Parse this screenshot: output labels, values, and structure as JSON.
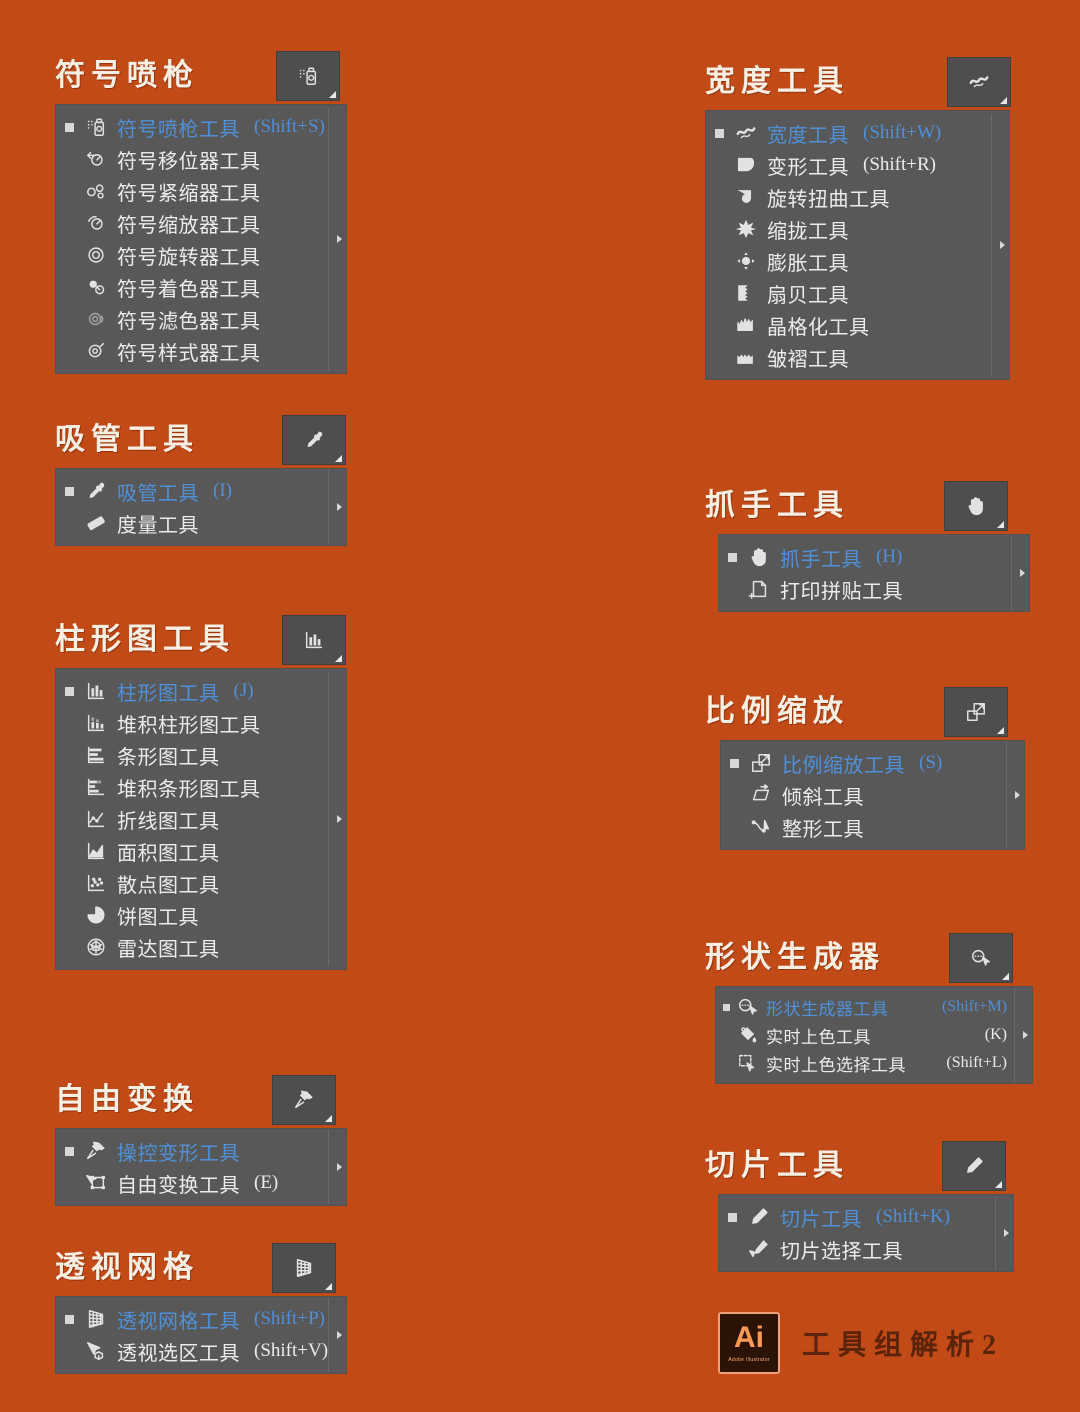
{
  "background_color": "#c14a17",
  "panel_color": "#585858",
  "highlight_color": "#4f90d8",
  "label_color": "#ececec",
  "title_color": "#f7efe3",
  "footer": {
    "logo_text": "Ai",
    "logo_sub": "Adobe Illustrator",
    "caption": "工具组解析2"
  },
  "groups": [
    {
      "id": "symbol-sprayer",
      "title": "符号喷枪",
      "head_icon": "symbol-sprayer-icon",
      "items": [
        {
          "label": "符号喷枪工具",
          "shortcut": "(Shift+S)",
          "selected": true,
          "icon": "symbol-sprayer-icon"
        },
        {
          "label": "符号移位器工具",
          "shortcut": "",
          "selected": false,
          "icon": "symbol-shifter-icon"
        },
        {
          "label": "符号紧缩器工具",
          "shortcut": "",
          "selected": false,
          "icon": "symbol-scruncher-icon"
        },
        {
          "label": "符号缩放器工具",
          "shortcut": "",
          "selected": false,
          "icon": "symbol-sizer-icon"
        },
        {
          "label": "符号旋转器工具",
          "shortcut": "",
          "selected": false,
          "icon": "symbol-spinner-icon"
        },
        {
          "label": "符号着色器工具",
          "shortcut": "",
          "selected": false,
          "icon": "symbol-stainer-icon"
        },
        {
          "label": "符号滤色器工具",
          "shortcut": "",
          "selected": false,
          "icon": "symbol-screener-icon"
        },
        {
          "label": "符号样式器工具",
          "shortcut": "",
          "selected": false,
          "icon": "symbol-styler-icon"
        }
      ]
    },
    {
      "id": "eyedropper",
      "title": "吸管工具",
      "head_icon": "eyedropper-icon",
      "items": [
        {
          "label": "吸管工具",
          "shortcut": "(I)",
          "selected": true,
          "icon": "eyedropper-icon"
        },
        {
          "label": "度量工具",
          "shortcut": "",
          "selected": false,
          "icon": "measure-icon"
        }
      ]
    },
    {
      "id": "column-graph",
      "title": "柱形图工具",
      "head_icon": "column-graph-icon",
      "items": [
        {
          "label": "柱形图工具",
          "shortcut": "(J)",
          "selected": true,
          "icon": "column-graph-icon"
        },
        {
          "label": "堆积柱形图工具",
          "shortcut": "",
          "selected": false,
          "icon": "stacked-column-graph-icon"
        },
        {
          "label": "条形图工具",
          "shortcut": "",
          "selected": false,
          "icon": "bar-graph-icon"
        },
        {
          "label": "堆积条形图工具",
          "shortcut": "",
          "selected": false,
          "icon": "stacked-bar-graph-icon"
        },
        {
          "label": "折线图工具",
          "shortcut": "",
          "selected": false,
          "icon": "line-graph-icon"
        },
        {
          "label": "面积图工具",
          "shortcut": "",
          "selected": false,
          "icon": "area-graph-icon"
        },
        {
          "label": "散点图工具",
          "shortcut": "",
          "selected": false,
          "icon": "scatter-graph-icon"
        },
        {
          "label": "饼图工具",
          "shortcut": "",
          "selected": false,
          "icon": "pie-graph-icon"
        },
        {
          "label": "雷达图工具",
          "shortcut": "",
          "selected": false,
          "icon": "radar-graph-icon"
        }
      ]
    },
    {
      "id": "free-transform",
      "title": "自由变换",
      "head_icon": "puppet-warp-icon",
      "items": [
        {
          "label": "操控变形工具",
          "shortcut": "",
          "selected": true,
          "icon": "puppet-warp-icon"
        },
        {
          "label": "自由变换工具",
          "shortcut": "(E)",
          "selected": false,
          "icon": "free-transform-icon"
        }
      ]
    },
    {
      "id": "perspective-grid",
      "title": "透视网格",
      "head_icon": "perspective-grid-icon",
      "items": [
        {
          "label": "透视网格工具",
          "shortcut": "(Shift+P)",
          "selected": true,
          "icon": "perspective-grid-icon"
        },
        {
          "label": "透视选区工具",
          "shortcut": "(Shift+V)",
          "selected": false,
          "icon": "perspective-selection-icon"
        }
      ]
    },
    {
      "id": "width-tool",
      "title": "宽度工具",
      "head_icon": "width-icon",
      "items": [
        {
          "label": "宽度工具",
          "shortcut": "(Shift+W)",
          "selected": true,
          "icon": "width-icon"
        },
        {
          "label": "变形工具",
          "shortcut": "(Shift+R)",
          "selected": false,
          "icon": "warp-icon"
        },
        {
          "label": "旋转扭曲工具",
          "shortcut": "",
          "selected": false,
          "icon": "twirl-icon"
        },
        {
          "label": "缩拢工具",
          "shortcut": "",
          "selected": false,
          "icon": "pucker-icon"
        },
        {
          "label": "膨胀工具",
          "shortcut": "",
          "selected": false,
          "icon": "bloat-icon"
        },
        {
          "label": "扇贝工具",
          "shortcut": "",
          "selected": false,
          "icon": "scallop-icon"
        },
        {
          "label": "晶格化工具",
          "shortcut": "",
          "selected": false,
          "icon": "crystallize-icon"
        },
        {
          "label": "皱褶工具",
          "shortcut": "",
          "selected": false,
          "icon": "wrinkle-icon"
        }
      ]
    },
    {
      "id": "hand-tool",
      "title": "抓手工具",
      "head_icon": "hand-icon",
      "items": [
        {
          "label": "抓手工具",
          "shortcut": "(H)",
          "selected": true,
          "icon": "hand-icon"
        },
        {
          "label": "打印拼贴工具",
          "shortcut": "",
          "selected": false,
          "icon": "print-tiling-icon"
        }
      ]
    },
    {
      "id": "scale-tool",
      "title": "比例缩放",
      "head_icon": "scale-icon",
      "items": [
        {
          "label": "比例缩放工具",
          "shortcut": "(S)",
          "selected": true,
          "icon": "scale-icon"
        },
        {
          "label": "倾斜工具",
          "shortcut": "",
          "selected": false,
          "icon": "shear-icon"
        },
        {
          "label": "整形工具",
          "shortcut": "",
          "selected": false,
          "icon": "reshape-icon"
        }
      ]
    },
    {
      "id": "shape-builder",
      "title": "形状生成器",
      "head_icon": "shape-builder-icon",
      "compact": true,
      "items": [
        {
          "label": "形状生成器工具",
          "shortcut": "(Shift+M)",
          "selected": true,
          "icon": "shape-builder-icon"
        },
        {
          "label": "实时上色工具",
          "shortcut": "(K)",
          "selected": false,
          "icon": "live-paint-bucket-icon"
        },
        {
          "label": "实时上色选择工具",
          "shortcut": "(Shift+L)",
          "selected": false,
          "icon": "live-paint-selection-icon"
        }
      ]
    },
    {
      "id": "slice-tool",
      "title": "切片工具",
      "head_icon": "slice-icon",
      "items": [
        {
          "label": "切片工具",
          "shortcut": "(Shift+K)",
          "selected": true,
          "icon": "slice-icon"
        },
        {
          "label": "切片选择工具",
          "shortcut": "",
          "selected": false,
          "icon": "slice-selection-icon"
        }
      ]
    }
  ]
}
